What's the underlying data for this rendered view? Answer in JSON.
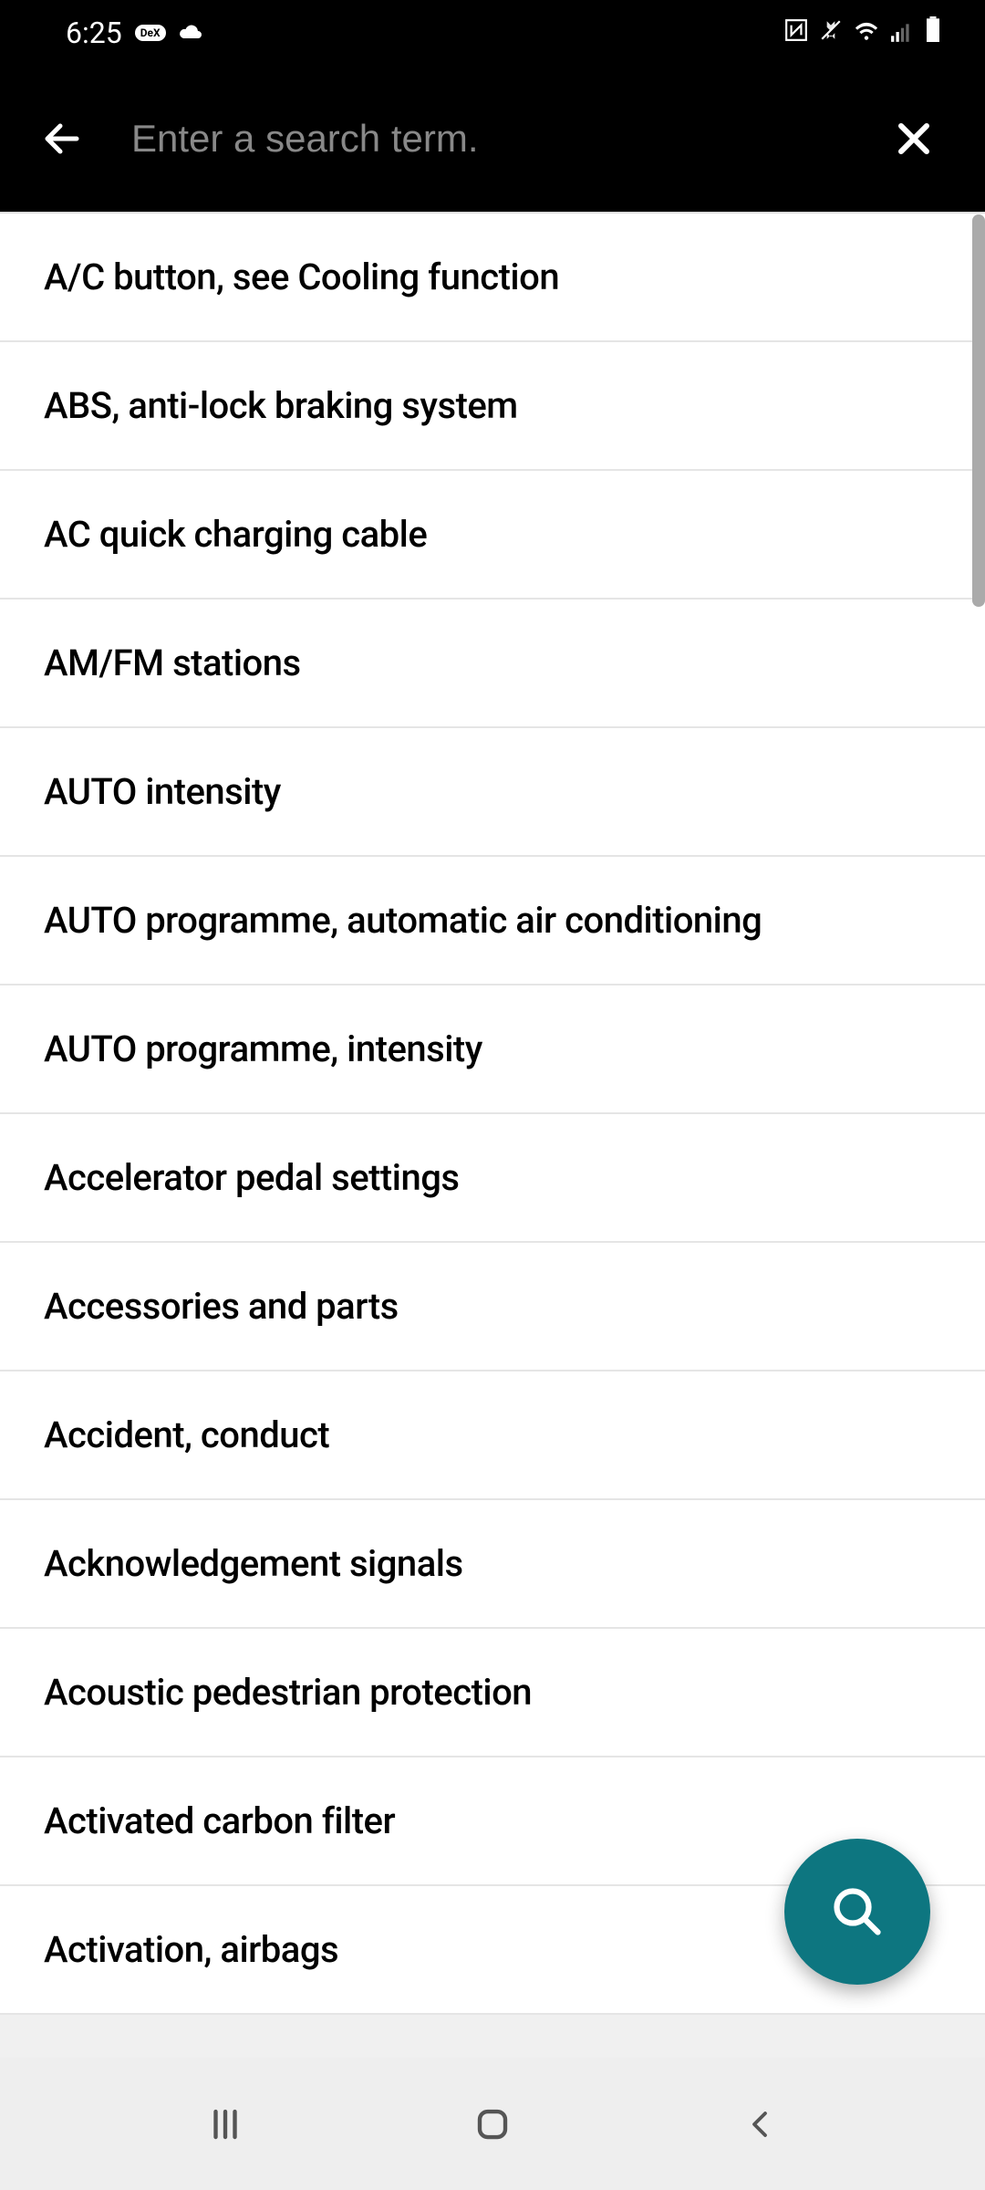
{
  "status_bar": {
    "time": "6:25",
    "dex_label": "DeX"
  },
  "header": {
    "search_placeholder": "Enter a search term."
  },
  "list": {
    "items": [
      "A/C button, see Cooling function",
      "ABS, anti-lock braking system",
      "AC quick charging cable",
      "AM/FM stations",
      "AUTO intensity",
      "AUTO programme, automatic air conditioning",
      "AUTO programme, intensity",
      "Accelerator pedal settings",
      "Accessories and parts",
      "Accident, conduct",
      "Acknowledgement signals",
      "Acoustic pedestrian protection",
      "Activated carbon filter",
      "Activation, airbags"
    ]
  },
  "colors": {
    "fab_bg": "#0d7680",
    "header_bg": "#000000",
    "list_bg": "#ffffff"
  }
}
